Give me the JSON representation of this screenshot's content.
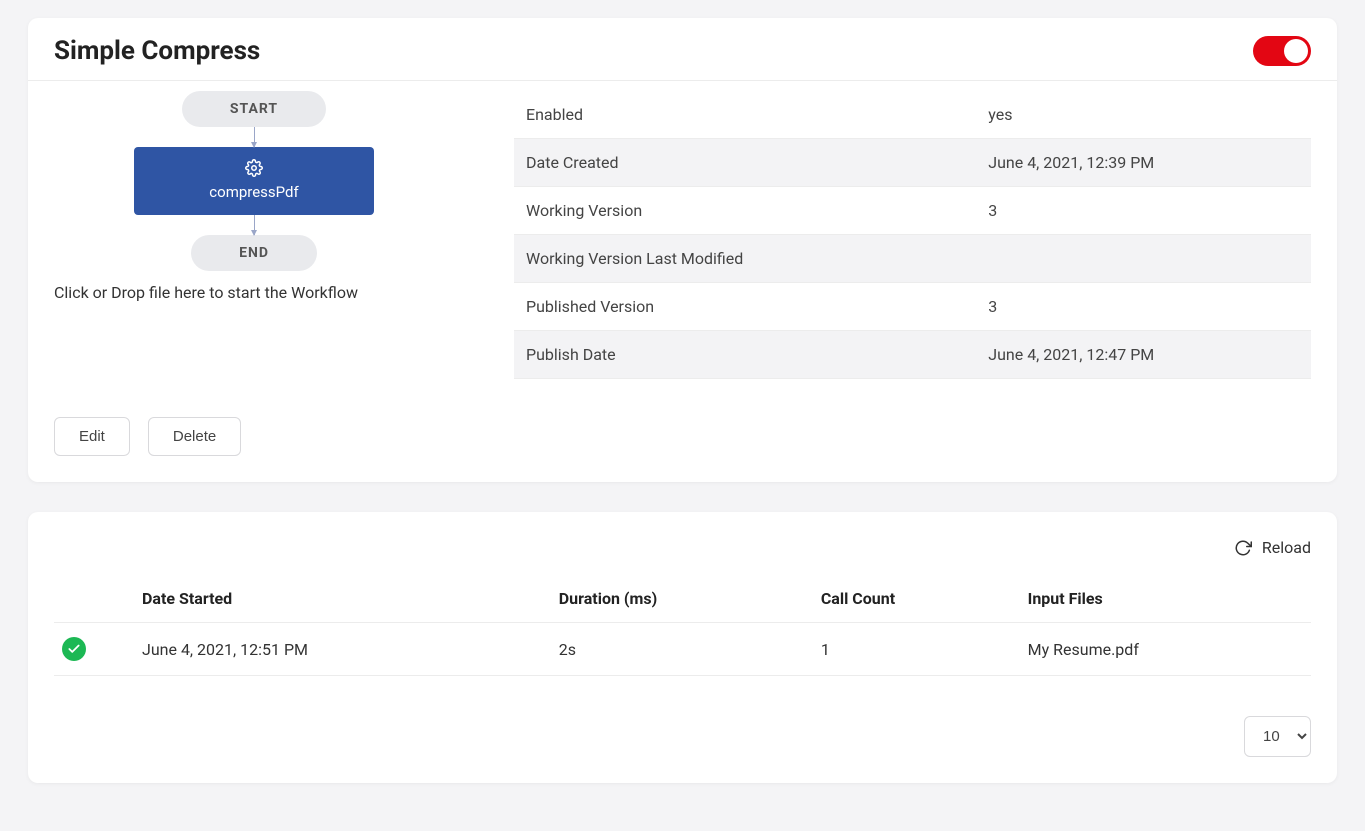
{
  "header": {
    "title": "Simple Compress",
    "toggle_on": true
  },
  "flow": {
    "start": "START",
    "node": "compressPdf",
    "end": "END",
    "hint": "Click or Drop file here to start the Workflow"
  },
  "info": [
    {
      "label": "Enabled",
      "value": "yes"
    },
    {
      "label": "Date Created",
      "value": "June 4, 2021, 12:39 PM"
    },
    {
      "label": "Working Version",
      "value": "3"
    },
    {
      "label": "Working Version Last Modified",
      "value": ""
    },
    {
      "label": "Published Version",
      "value": "3"
    },
    {
      "label": "Publish Date",
      "value": "June 4, 2021, 12:47 PM"
    }
  ],
  "actions": {
    "edit": "Edit",
    "delete": "Delete"
  },
  "runs": {
    "reload": "Reload",
    "columns": {
      "date_started": "Date Started",
      "duration": "Duration (ms)",
      "call_count": "Call Count",
      "input_files": "Input Files"
    },
    "rows": [
      {
        "status": "ok",
        "date_started": "June 4, 2021, 12:51 PM",
        "duration": "2s",
        "call_count": "1",
        "input_files": "My Resume.pdf"
      }
    ],
    "page_size": "10"
  }
}
